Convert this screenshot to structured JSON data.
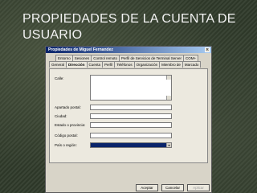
{
  "slide": {
    "title": "PROPIEDADES DE LA CUENTA DE USUARIO"
  },
  "dialog": {
    "title": "Propiedades de Miguel Fernandez",
    "close_glyph": "×",
    "tabs_row1": [
      "Entorno",
      "Sesiones",
      "Control remoto",
      "Perfil de Servicios de Terminal Server",
      "COM+"
    ],
    "tabs_row2": [
      "General",
      "Dirección",
      "Cuenta",
      "Perfil",
      "Teléfonos",
      "Organización",
      "Miembro de",
      "Marcado"
    ],
    "active_tab": "Dirección",
    "fields": {
      "calle": "Calle:",
      "apartado": "Apartado postal:",
      "ciudad": "Ciudad:",
      "estado": "Estado o provincia:",
      "codigo": "Código postal:",
      "pais": "País o región:"
    },
    "buttons": {
      "aceptar": "Aceptar",
      "cancelar": "Cancelar",
      "aplicar": "Aplicar"
    }
  },
  "colors": {
    "titlebar": "#0a246a",
    "selected_field": "#0a246a"
  }
}
